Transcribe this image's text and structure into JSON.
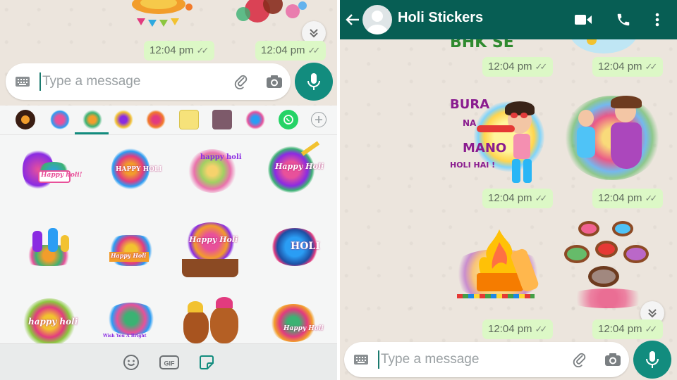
{
  "left_panel": {
    "timestamps": [
      "12:04 pm",
      "12:04 pm"
    ],
    "composer": {
      "placeholder": "Type a message"
    },
    "sticker_tabs": [
      "recent",
      "pack-1",
      "pack-2",
      "pack-3",
      "pack-4",
      "pack-5",
      "pack-6",
      "pack-7",
      "whatsapp",
      "add"
    ],
    "stickers": [
      {
        "label": "Happy holi!"
      },
      {
        "label": "HAPPY HOLI"
      },
      {
        "label": "happy holi"
      },
      {
        "label": "Happy Holi"
      },
      {
        "label": ""
      },
      {
        "label": "Happy Holi"
      },
      {
        "label": "Happy Holi"
      },
      {
        "label": "HOLI"
      },
      {
        "label": "happy holi"
      },
      {
        "label": "Wish You A Bright"
      },
      {
        "label": ""
      },
      {
        "label": "Happy Holi"
      }
    ],
    "bottom_bar": [
      "emoji-icon",
      "gif-icon",
      "sticker-icon"
    ]
  },
  "right_panel": {
    "header": {
      "title": "Holi Stickers"
    },
    "partial_sticker_text": "BHK SE",
    "sticker_text": {
      "line1": "BURA",
      "line2": "NA",
      "line3": "MANO",
      "line4": "HOLI HAI !"
    },
    "timestamps": [
      "12:04 pm",
      "12:04 pm",
      "12:04 pm",
      "12:04 pm",
      "12:04 pm",
      "12:04 pm"
    ],
    "composer": {
      "placeholder": "Type a message"
    }
  },
  "colors": {
    "header": "#075e54",
    "accent": "#128c7e",
    "bubble": "#dcf8c6",
    "chat_bg": "#ece5dd"
  }
}
